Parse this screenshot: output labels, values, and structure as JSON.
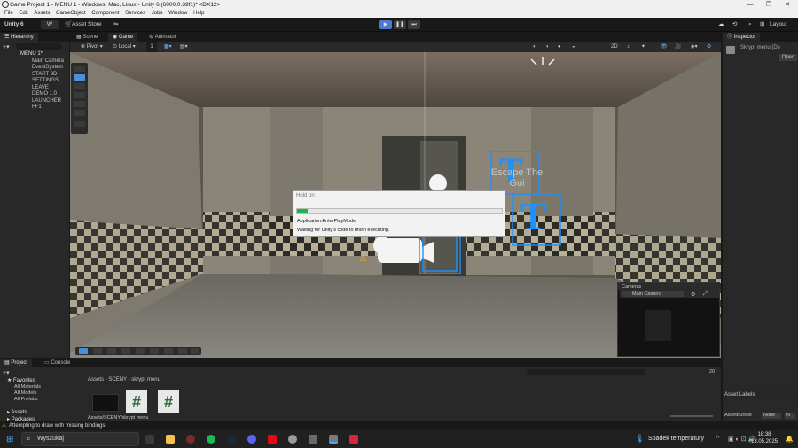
{
  "window": {
    "title": "Game Project 1 - MENU 1 - Windows, Mac, Linux - Unity 6 (6000.0.39f1)* <DX12>",
    "controls": [
      "—",
      "❐",
      "✕"
    ]
  },
  "menubar": [
    "File",
    "Edit",
    "Assets",
    "GameObject",
    "Component",
    "Services",
    "Jobs",
    "Window",
    "Help"
  ],
  "toolbar": {
    "unity_label": "Unity 6",
    "account_label": "W",
    "asset_store_label": "Asset Store",
    "layout_label": "Layout"
  },
  "hierarchy": {
    "tab": "Hierarchy",
    "items": [
      "MENU 1*",
      "Main Camera",
      "EventSystem",
      "START 3D",
      "SETTINGS",
      "LEAVE",
      "DEMO 1.0",
      "LAUNCHER",
      "FF1"
    ]
  },
  "center_tabs": [
    "Scene",
    "Game",
    "Animator"
  ],
  "scene_toolbar": {
    "pivot_label": "Pivot",
    "local_label": "Local",
    "grid_value": "1",
    "mode_2d": "2D"
  },
  "scene": {
    "sign_letters": [
      "T",
      "T"
    ],
    "sign_text": "Escape The Gui"
  },
  "dialog": {
    "title": "Hold on",
    "progress": 0.05,
    "line1": "Application.EnterPlayMode",
    "line2": "Waiting for Unity's code to finish executing."
  },
  "cameras_overlay": {
    "title": "Cameras",
    "selected": "Main Camera"
  },
  "inspector": {
    "tab": "Inspector",
    "object_name": "Skrypt menu (De",
    "open_button": "Open",
    "asset_labels": "Asset Labels",
    "asset_bundle_label": "AssetBundle",
    "asset_bundle_value": "None",
    "variant_value": "N"
  },
  "project": {
    "tabs": [
      "Project",
      "Console"
    ],
    "favorites_label": "Favorites",
    "favorites": [
      "All Materials",
      "All Models",
      "All Prefabs"
    ],
    "roots": [
      "Assets",
      "Packages"
    ],
    "breadcrumb": [
      "Assets",
      "SCENY",
      "skrypt menu"
    ],
    "path": "Assets/SCENY/skrypt menu",
    "hidden_count": "20"
  },
  "status": {
    "message": "Attempting to draw with missing bindings"
  },
  "taskbar": {
    "search_placeholder": "Wyszukaj",
    "weather": "Spadek temperatury",
    "time": "18:38",
    "date": "13.05.2025"
  },
  "colors": {
    "accent": "#4a90d9",
    "unity_blue": "#1e90ff",
    "progress": "#22b14c",
    "warning": "#f0b400"
  }
}
